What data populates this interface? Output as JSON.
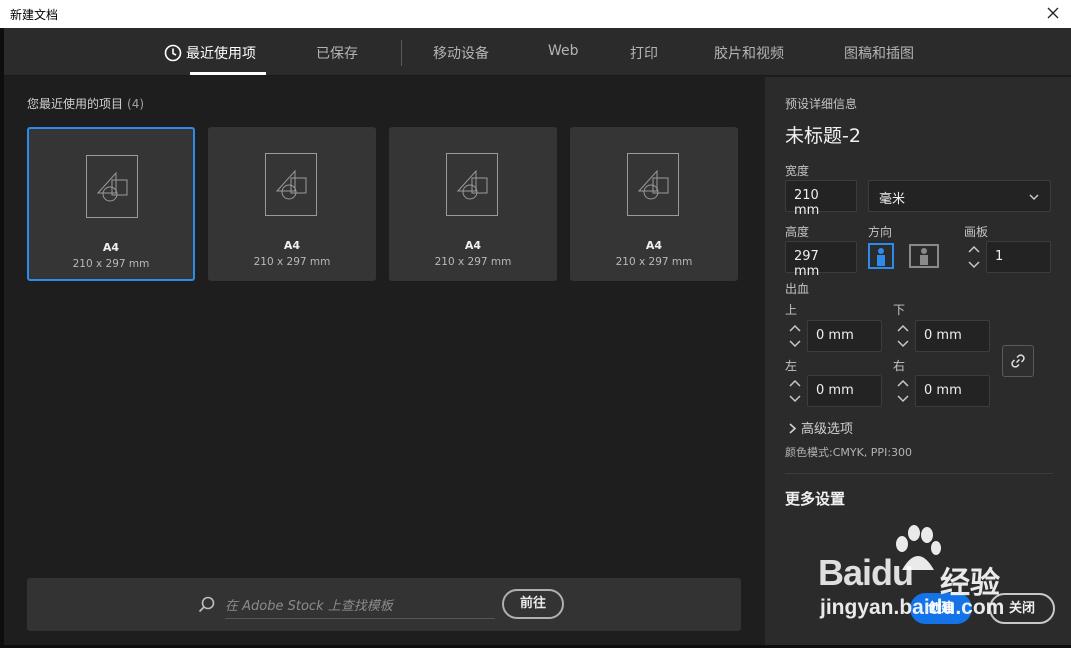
{
  "window": {
    "title": "新建文档",
    "close_icon": "close-icon"
  },
  "tabs": [
    {
      "label": "最近使用项",
      "active": true,
      "icon": "clock-icon"
    },
    {
      "label": "已保存",
      "active": false
    },
    {
      "label": "移动设备",
      "active": false
    },
    {
      "label": "Web",
      "active": false
    },
    {
      "label": "打印",
      "active": false
    },
    {
      "label": "胶片和视频",
      "active": false
    },
    {
      "label": "图稿和插图",
      "active": false
    }
  ],
  "recent": {
    "header": "您最近使用的项目",
    "count": "(4)",
    "items": [
      {
        "name": "A4",
        "size": "210 x 297 mm",
        "selected": true
      },
      {
        "name": "A4",
        "size": "210 x 297 mm",
        "selected": false
      },
      {
        "name": "A4",
        "size": "210 x 297 mm",
        "selected": false
      },
      {
        "name": "A4",
        "size": "210 x 297 mm",
        "selected": false
      }
    ]
  },
  "stock": {
    "placeholder": "在 Adobe Stock 上查找模板",
    "go_label": "前往"
  },
  "details": {
    "section_title": "预设详细信息",
    "doc_name": "未标题-2",
    "width_label": "宽度",
    "width_value": "210 mm",
    "unit_value": "毫米",
    "height_label": "高度",
    "height_value": "297 mm",
    "orientation_label": "方向",
    "orientation_selected": "portrait",
    "artboards_label": "画板",
    "artboards_value": "1",
    "bleed_label": "出血",
    "bleed_top_label": "上",
    "bleed_top_value": "0 mm",
    "bleed_bottom_label": "下",
    "bleed_bottom_value": "0 mm",
    "bleed_left_label": "左",
    "bleed_left_value": "0 mm",
    "bleed_right_label": "右",
    "bleed_right_value": "0 mm",
    "advanced_label": "高级选项",
    "color_mode": "颜色模式:CMYK, PPI:300",
    "more_settings": "更多设置"
  },
  "actions": {
    "create_label": "创建",
    "close_label": "关闭"
  },
  "watermark": {
    "brand": "Baidu",
    "cn": "经验",
    "url": "jingyan.baidu.com"
  },
  "colors": {
    "accent": "#2d8ceb",
    "create_button": "#1473e6",
    "panel_bg": "#2b2b2b",
    "content_bg": "#1e1e1e",
    "card_bg": "#353535"
  }
}
